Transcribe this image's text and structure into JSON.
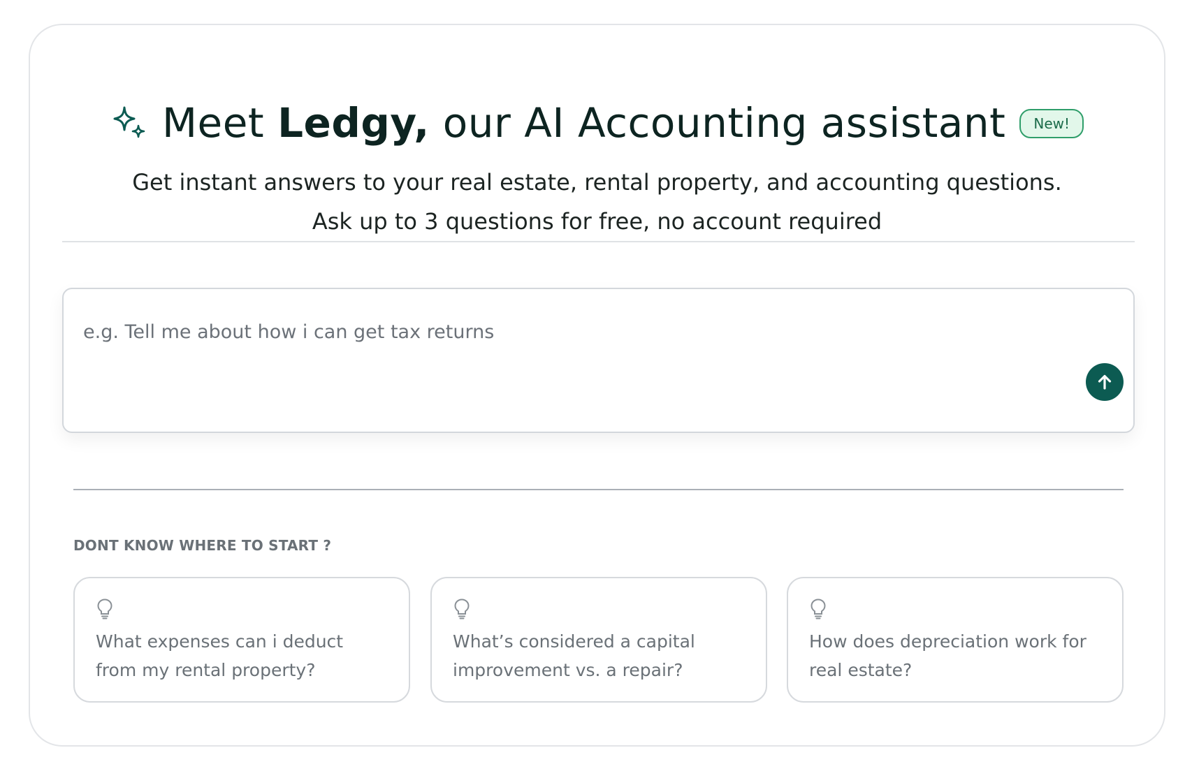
{
  "header": {
    "title_prefix": "Meet ",
    "title_brand": "Ledgy,",
    "title_suffix": " our AI Accounting assistant",
    "badge": "New!",
    "subtitle_line1": "Get instant answers to your real estate, rental property, and accounting questions.",
    "subtitle_line2": "Ask up to 3 questions for free, no account required"
  },
  "input": {
    "value": "",
    "placeholder": "e.g. Tell me about how i can get tax returns",
    "send_icon": "arrow-up-icon"
  },
  "suggestions": {
    "label": "DONT KNOW WHERE TO START ?",
    "items": [
      {
        "icon": "lightbulb-icon",
        "text": "What expenses can i deduct from my rental property?"
      },
      {
        "icon": "lightbulb-icon",
        "text": "What’s considered a capital improvement vs. a repair?"
      },
      {
        "icon": "lightbulb-icon",
        "text": "How does depreciation work for real estate?"
      }
    ]
  },
  "colors": {
    "accent": "#0c5b52",
    "badge_bg": "#e2f7ea",
    "badge_border": "#2f9e6a",
    "muted_text": "#6a7177",
    "title_text": "#0d2421"
  }
}
